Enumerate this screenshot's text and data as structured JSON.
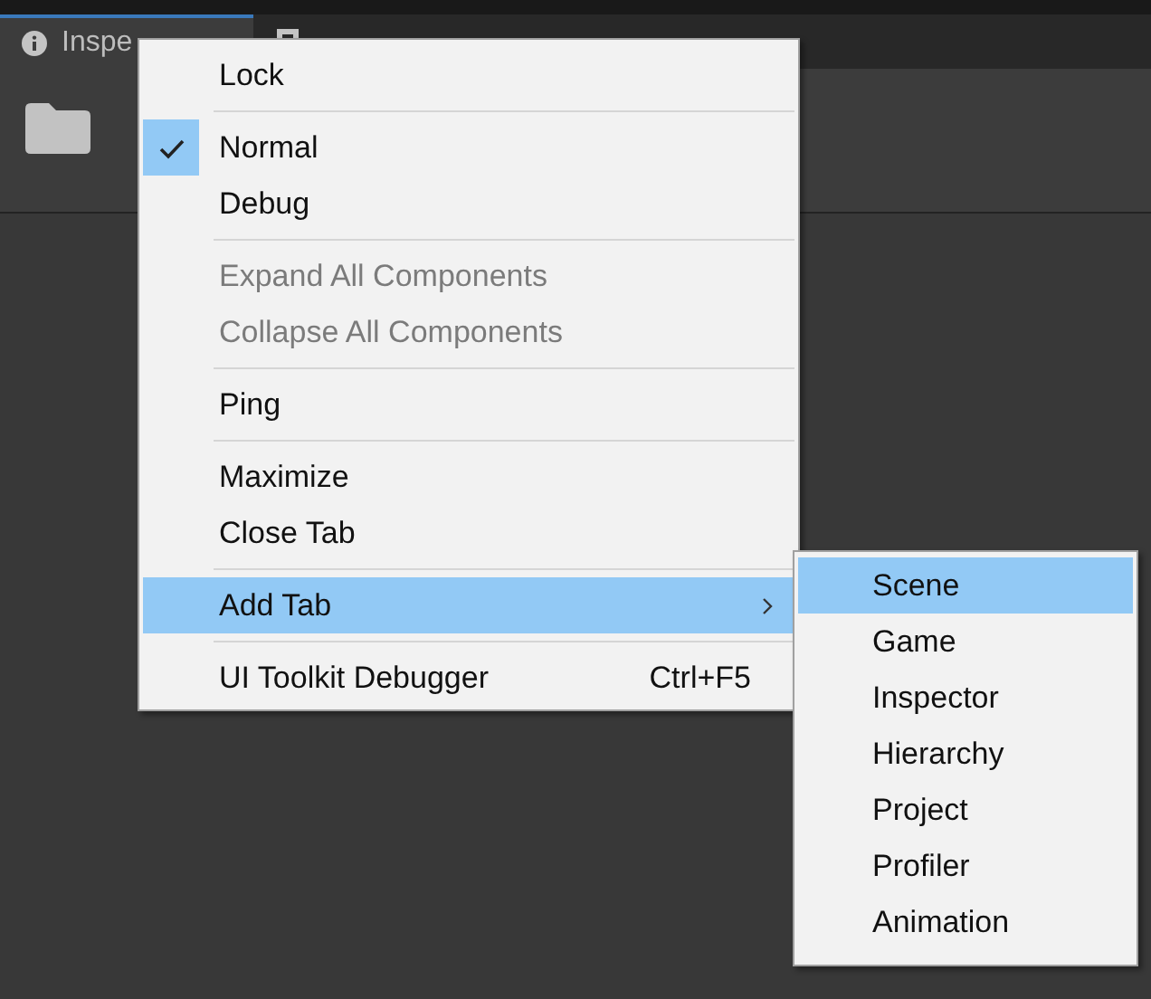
{
  "tabs": [
    {
      "label": "Inspe",
      "selected": true
    },
    {
      "selected": false
    }
  ],
  "context_menu": {
    "items": [
      {
        "kind": "item",
        "label": "Lock",
        "checked": false,
        "disabled": false,
        "selected": false
      },
      {
        "kind": "separator"
      },
      {
        "kind": "item",
        "label": "Normal",
        "checked": true,
        "disabled": false,
        "selected": false
      },
      {
        "kind": "item",
        "label": "Debug",
        "checked": false,
        "disabled": false,
        "selected": false
      },
      {
        "kind": "separator"
      },
      {
        "kind": "item",
        "label": "Expand All Components",
        "checked": false,
        "disabled": true,
        "selected": false
      },
      {
        "kind": "item",
        "label": "Collapse All Components",
        "checked": false,
        "disabled": true,
        "selected": false
      },
      {
        "kind": "separator"
      },
      {
        "kind": "item",
        "label": "Ping",
        "checked": false,
        "disabled": false,
        "selected": false
      },
      {
        "kind": "separator"
      },
      {
        "kind": "item",
        "label": "Maximize",
        "checked": false,
        "disabled": false,
        "selected": false
      },
      {
        "kind": "item",
        "label": "Close Tab",
        "checked": false,
        "disabled": false,
        "selected": false
      },
      {
        "kind": "separator"
      },
      {
        "kind": "submenu",
        "label": "Add Tab",
        "checked": false,
        "disabled": false,
        "selected": true
      },
      {
        "kind": "separator"
      },
      {
        "kind": "item",
        "label": "UI Toolkit Debugger",
        "shortcut": "Ctrl+F5",
        "checked": false,
        "disabled": false,
        "selected": false
      }
    ]
  },
  "submenu": {
    "items": [
      {
        "label": "Scene",
        "selected": true
      },
      {
        "label": "Game",
        "selected": false
      },
      {
        "label": "Inspector",
        "selected": false
      },
      {
        "label": "Hierarchy",
        "selected": false
      },
      {
        "label": "Project",
        "selected": false
      },
      {
        "label": "Profiler",
        "selected": false
      },
      {
        "label": "Animation",
        "selected": false
      }
    ]
  }
}
